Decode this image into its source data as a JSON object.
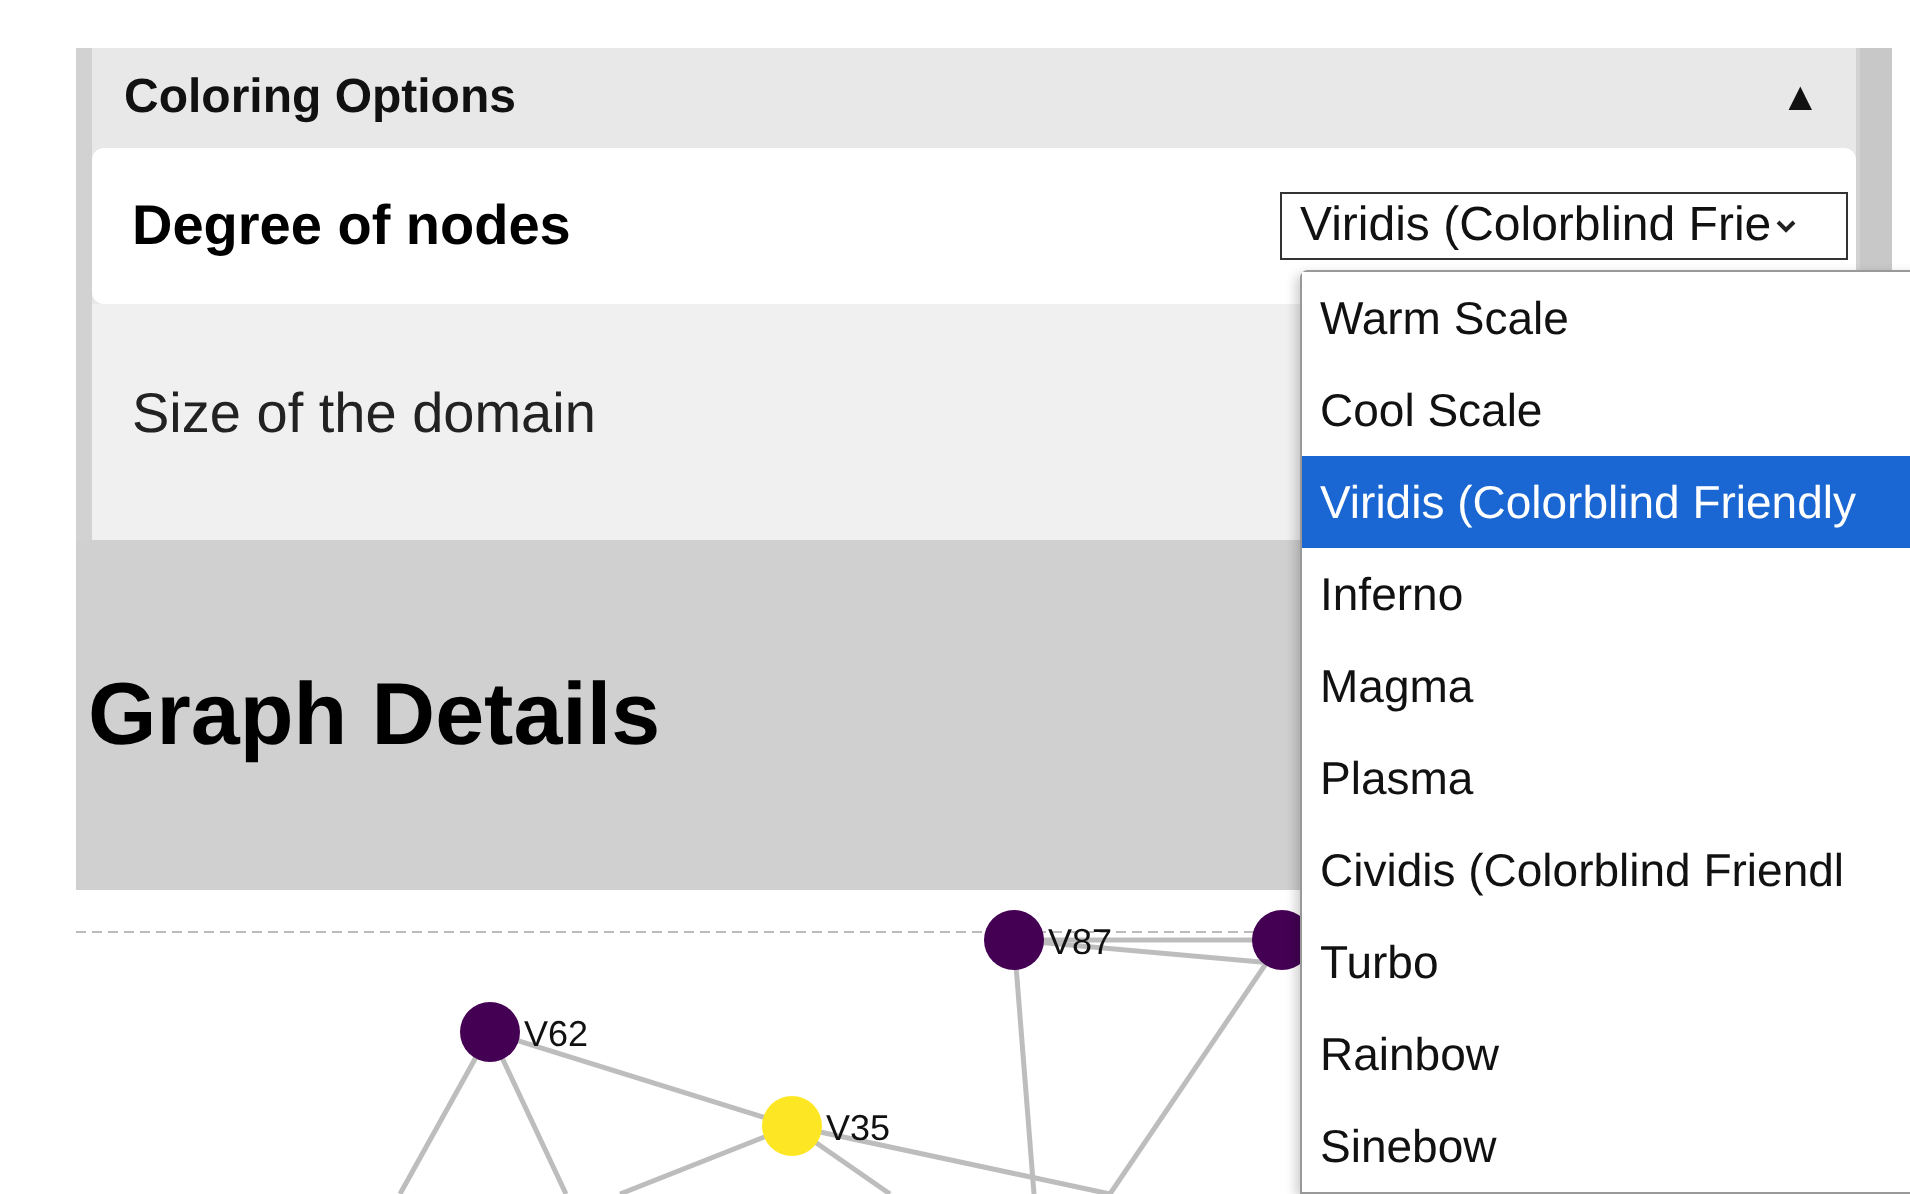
{
  "panel": {
    "title": "Coloring Options",
    "toggle": "▲",
    "expanded": true
  },
  "rows": [
    {
      "label": "Degree of nodes",
      "selected": true,
      "value": "Viridis (Colorblind Frie"
    },
    {
      "label": "Size of the domain",
      "selected": false
    }
  ],
  "dropdown": {
    "options": [
      {
        "label": "Warm Scale",
        "selected": false
      },
      {
        "label": "Cool Scale",
        "selected": false
      },
      {
        "label": "Viridis (Colorblind Friendly",
        "selected": true
      },
      {
        "label": "Inferno",
        "selected": false
      },
      {
        "label": "Magma",
        "selected": false
      },
      {
        "label": "Plasma",
        "selected": false
      },
      {
        "label": "Cividis (Colorblind Friendl",
        "selected": false
      },
      {
        "label": "Turbo",
        "selected": false
      },
      {
        "label": "Rainbow",
        "selected": false
      },
      {
        "label": "Sinebow",
        "selected": false
      }
    ]
  },
  "section_title": "Graph Details",
  "graph": {
    "nodes": [
      {
        "label": "V87",
        "color": "#440154"
      },
      {
        "color": "#440154"
      },
      {
        "label": "V62",
        "color": "#440154"
      },
      {
        "label": "V35",
        "color": "#fde725"
      }
    ]
  }
}
